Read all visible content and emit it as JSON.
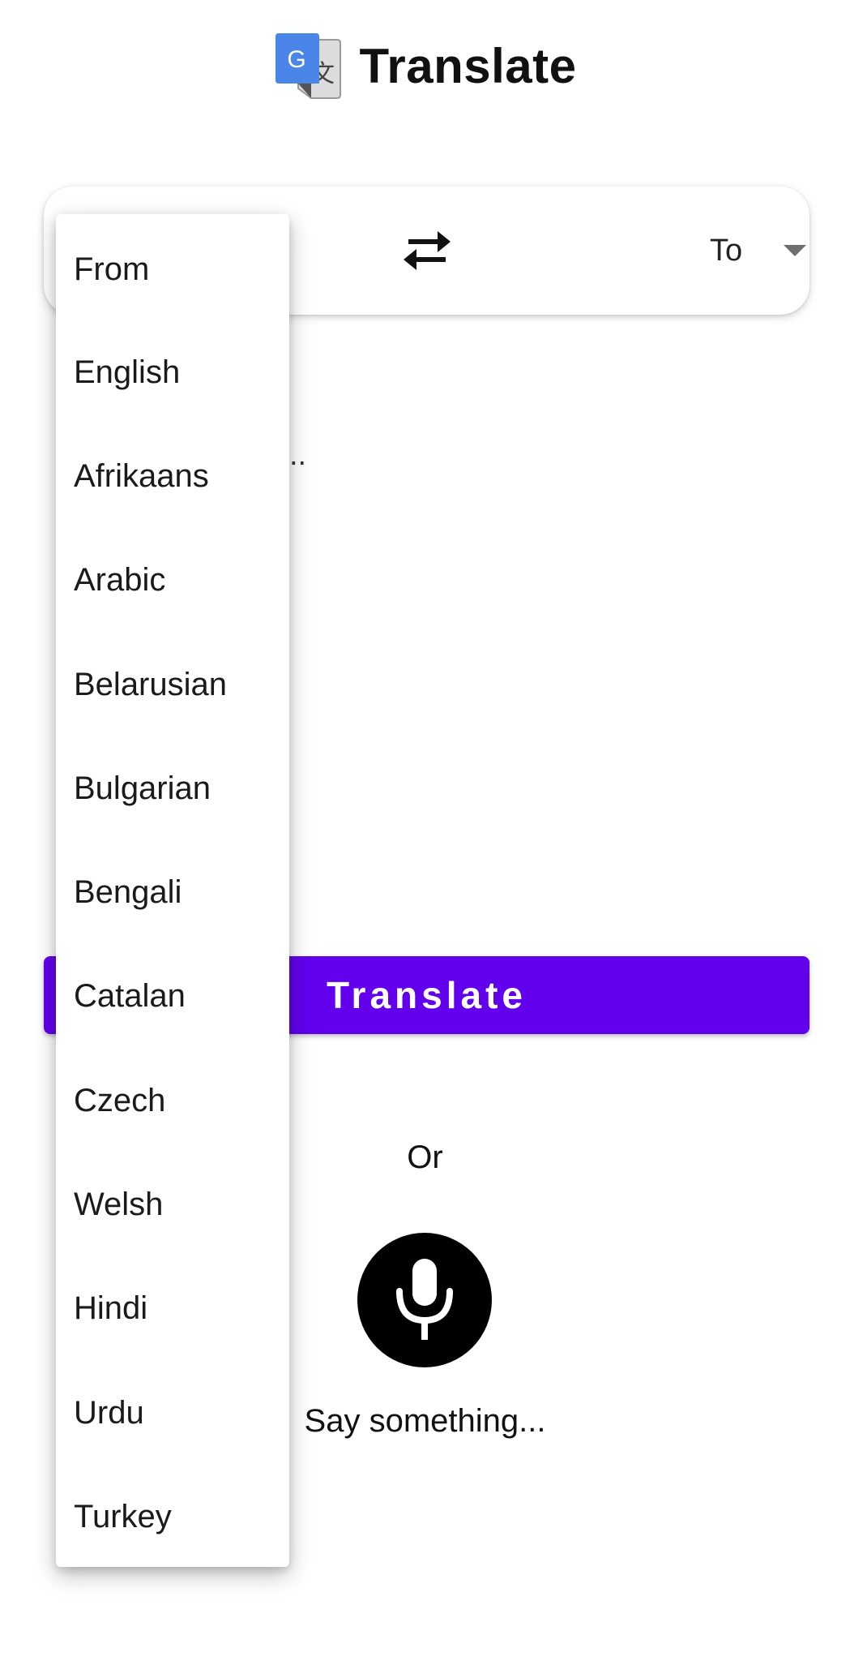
{
  "header": {
    "title": "Translate",
    "logo_icon": "google-translate-icon",
    "logo_letter": "G",
    "logo_glyph": "文",
    "colors": {
      "logo_blue": "#4a86e8",
      "logo_gray": "#dcdcdc"
    }
  },
  "language_bar": {
    "swap_icon": "swap-arrows-icon",
    "to_label": "To",
    "to_caret_icon": "dropdown-caret-icon"
  },
  "input": {
    "placeholder": "Enter text...",
    "visible_fragment": ".."
  },
  "actions": {
    "translate_label": "Translate",
    "or_label": "Or",
    "mic_icon": "microphone-icon",
    "mic_hint": "Say something...",
    "colors": {
      "primary": "#6200ee",
      "mic_background": "#000000"
    }
  },
  "from_dropdown": {
    "open": true,
    "options": [
      "From",
      "English",
      "Afrikaans",
      "Arabic",
      "Belarusian",
      "Bulgarian",
      "Bengali",
      "Catalan",
      "Czech",
      "Welsh",
      "Hindi",
      "Urdu",
      "Turkey"
    ]
  }
}
